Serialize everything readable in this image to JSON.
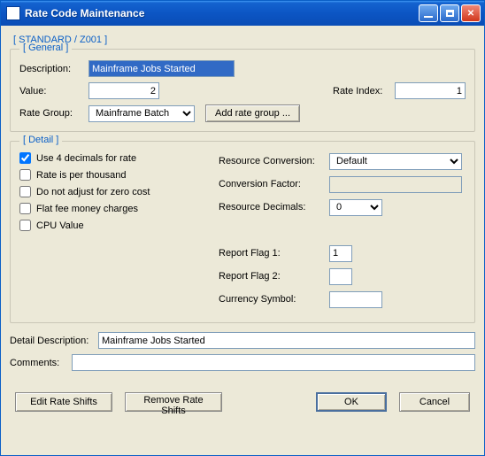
{
  "window": {
    "title": "Rate Code Maintenance"
  },
  "subtitle": "[ STANDARD / Z001     ]",
  "general": {
    "legend": "[ General ]",
    "descriptionLabel": "Description:",
    "description": "Mainframe Jobs Started",
    "valueLabel": "Value:",
    "value": "2",
    "rateIndexLabel": "Rate Index:",
    "rateIndex": "1",
    "rateGroupLabel": "Rate Group:",
    "rateGroup": "Mainframe Batch",
    "addRateGroupBtn": "Add rate group ..."
  },
  "detail": {
    "legend": "[ Detail ]",
    "checks": {
      "use4decimals": {
        "label": "Use 4 decimals for rate",
        "checked": true
      },
      "perThousand": {
        "label": "Rate is per thousand",
        "checked": false
      },
      "noAdjustZero": {
        "label": "Do not adjust for zero cost",
        "checked": false
      },
      "flatFee": {
        "label": "Flat fee money charges",
        "checked": false
      },
      "cpuValue": {
        "label": "CPU Value",
        "checked": false
      }
    },
    "resourceConversionLabel": "Resource Conversion:",
    "resourceConversion": "Default",
    "conversionFactorLabel": "Conversion Factor:",
    "conversionFactor": "",
    "resourceDecimalsLabel": "Resource Decimals:",
    "resourceDecimals": "0",
    "reportFlag1Label": "Report Flag 1:",
    "reportFlag1": "1",
    "reportFlag2Label": "Report Flag 2:",
    "reportFlag2": "",
    "currencySymbolLabel": "Currency Symbol:",
    "currencySymbol": ""
  },
  "detailDescLabel": "Detail Description:",
  "detailDesc": "Mainframe Jobs Started",
  "commentsLabel": "Comments:",
  "comments": "",
  "buttons": {
    "editShifts": "Edit Rate Shifts",
    "removeShifts": "Remove Rate Shifts",
    "ok": "OK",
    "cancel": "Cancel"
  }
}
